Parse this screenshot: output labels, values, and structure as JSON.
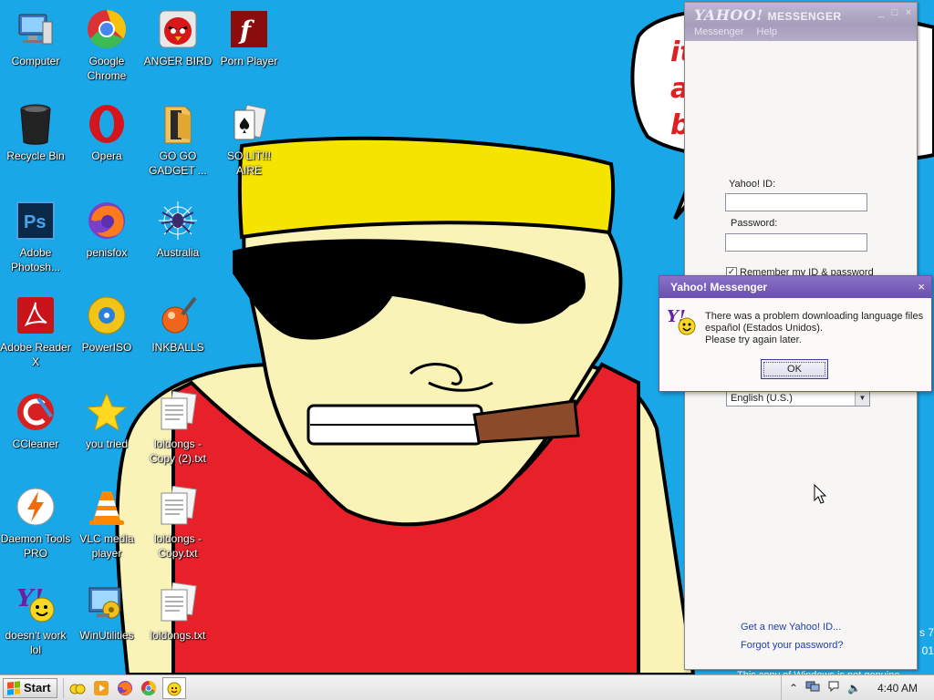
{
  "desktop": {
    "icons": [
      {
        "id": "computer",
        "label": "Computer",
        "icon": "computer-icon"
      },
      {
        "id": "google-chrome",
        "label": "Google Chrome",
        "icon": "chrome-icon"
      },
      {
        "id": "anger-bird",
        "label": "ANGER BIRD",
        "icon": "angry-bird-icon"
      },
      {
        "id": "porn-player",
        "label": "Porn Player",
        "icon": "flash-icon"
      },
      {
        "id": "recycle-bin",
        "label": "Recycle Bin",
        "icon": "recycle-bin-icon"
      },
      {
        "id": "opera",
        "label": "Opera",
        "icon": "opera-icon"
      },
      {
        "id": "go-go-gadget",
        "label": "GO GO GADGET ...",
        "icon": "folder-icon"
      },
      {
        "id": "so-lit-aire",
        "label": "SO LIT!!! AIRE",
        "icon": "solitaire-icon"
      },
      {
        "id": "adobe-photoshop",
        "label": "Adobe Photosh...",
        "icon": "photoshop-icon"
      },
      {
        "id": "penisfox",
        "label": "penisfox",
        "icon": "firefox-icon"
      },
      {
        "id": "australia",
        "label": "Australia",
        "icon": "spider-icon"
      },
      {
        "id": "adobe-reader",
        "label": "Adobe Reader X",
        "icon": "adobe-reader-icon"
      },
      {
        "id": "poweriso",
        "label": "PowerISO",
        "icon": "disc-icon"
      },
      {
        "id": "inkballs",
        "label": "INKBALLS",
        "icon": "inkball-icon"
      },
      {
        "id": "ccleaner",
        "label": "CCleaner",
        "icon": "ccleaner-icon"
      },
      {
        "id": "you-tried",
        "label": "you tried",
        "icon": "star-icon"
      },
      {
        "id": "loldongs-copy2",
        "label": "loldongs - Copy (2).txt",
        "icon": "text-file-icon"
      },
      {
        "id": "daemon-tools",
        "label": "Daemon Tools PRO",
        "icon": "daemon-tools-icon"
      },
      {
        "id": "vlc",
        "label": "VLC media player",
        "icon": "vlc-icon"
      },
      {
        "id": "loldongs-copy",
        "label": "loldongs - Copy.txt",
        "icon": "text-file-icon"
      },
      {
        "id": "doesnt-work",
        "label": "doesn't work lol",
        "icon": "yahoo-icon"
      },
      {
        "id": "winutilities",
        "label": "WinUtilities",
        "icon": "winutilities-icon"
      },
      {
        "id": "loldongs",
        "label": "loldongs.txt",
        "icon": "text-file-icon"
      }
    ],
    "speech_bubble_text": [
      "it",
      "a",
      "b"
    ]
  },
  "messenger": {
    "title_brand": "YAHOO!",
    "title_product": "MESSENGER",
    "title_controls": [
      "_",
      "□",
      "×"
    ],
    "menu": [
      "Messenger",
      "Help"
    ],
    "yahoo_id_label": "Yahoo! ID:",
    "yahoo_id_value": "",
    "password_label": "Password:",
    "password_value": "",
    "remember_label": "Remember my ID & password",
    "remember_checked": true,
    "language_value": "English (U.S.)",
    "link_new_id": "Get a new Yahoo! ID...",
    "link_forgot": "Forgot your password?"
  },
  "dialog": {
    "title": "Yahoo! Messenger",
    "close": "×",
    "message_lines": [
      "There was a problem downloading language files",
      "español (Estados Unidos).",
      "Please try again later."
    ],
    "ok_label": "OK"
  },
  "watermark": {
    "edge_text": [
      "s 7",
      "01"
    ],
    "bottom_text": "This copy of Windows is not genuine"
  },
  "taskbar": {
    "start_label": "Start",
    "quick_launch": [
      "messenger-buddies-icon",
      "media-player-icon",
      "firefox-icon",
      "chrome-icon"
    ],
    "active_item_icon": "yahoo-icon",
    "tray_icons": [
      "show-hidden-icons-icon",
      "network-icon",
      "action-center-icon",
      "volume-icon"
    ],
    "clock": "4:40 AM"
  },
  "colors": {
    "desktop_background": "#1aa7e8",
    "yahoo_purple": "#6a4fb0",
    "shirt_red": "#e8202a",
    "hair_yellow": "#f5e400",
    "skin": "#faf3b8"
  }
}
